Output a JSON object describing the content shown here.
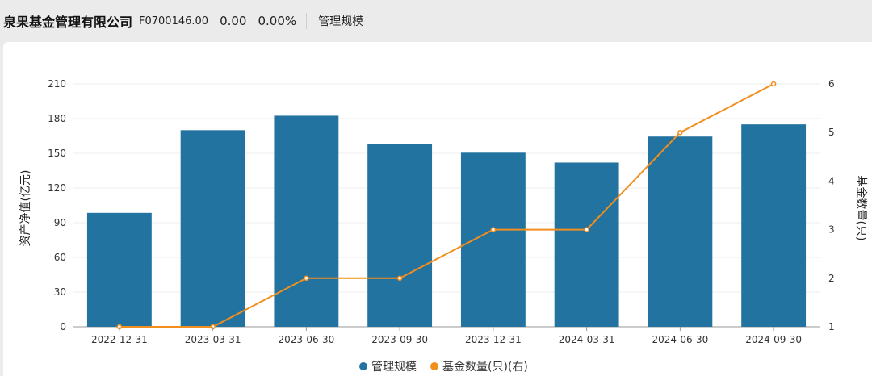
{
  "header": {
    "fund_name": "泉果基金管理有限公司",
    "fund_code": "F0700146.00",
    "price": "0.00",
    "change_pct": "0.00%",
    "tab_label": "管理规模"
  },
  "chart_data": {
    "type": "bar",
    "categories": [
      "2022-12-31",
      "2023-03-31",
      "2023-06-30",
      "2023-09-30",
      "2023-12-31",
      "2024-03-31",
      "2024-06-30",
      "2024-09-30"
    ],
    "series": [
      {
        "name": "管理规模",
        "type": "bar",
        "axis": "left",
        "color": "#2273a0",
        "values": [
          98.5,
          170,
          182.5,
          158,
          150.5,
          142,
          164.5,
          175
        ]
      },
      {
        "name": "基金数量(只)(右)",
        "type": "line",
        "axis": "right",
        "color": "#f28e1c",
        "values": [
          1,
          1,
          2,
          2,
          3,
          3,
          5,
          6
        ]
      }
    ],
    "ylabel_left": "资产净值(亿元)",
    "ylabel_right": "基金数量(只)",
    "ylim_left": [
      0,
      210
    ],
    "yticks_left": [
      0,
      30,
      60,
      90,
      120,
      150,
      180,
      210
    ],
    "ylim_right": [
      1,
      6
    ],
    "yticks_right": [
      1,
      2,
      3,
      4,
      5,
      6
    ],
    "grid": true,
    "legend": "bottom-center"
  }
}
